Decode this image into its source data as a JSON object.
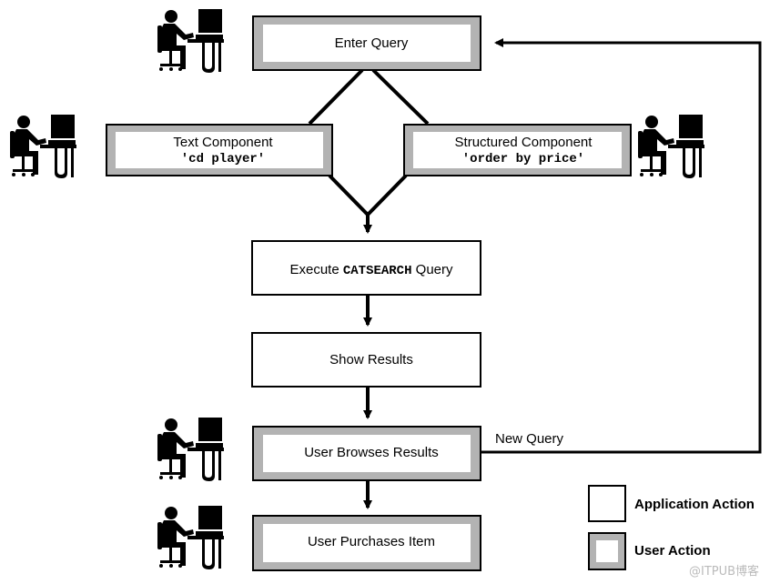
{
  "nodes": {
    "enter_query": "Enter Query",
    "text_component": {
      "label": "Text Component",
      "value": "'cd player'"
    },
    "structured_component": {
      "label": "Structured Component",
      "value": "'order by price'"
    },
    "execute": {
      "prefix": "Execute ",
      "keyword": "CATSEARCH",
      "suffix": " Query"
    },
    "show_results": "Show Results",
    "user_browses": "User Browses Results",
    "user_purchases": "User Purchases Item"
  },
  "edges": {
    "new_query": "New Query"
  },
  "legend": {
    "application_action": "Application Action",
    "user_action": "User Action"
  },
  "watermark": "@ITPUB博客",
  "colors": {
    "user_action_frame": "#b3b3b3",
    "stroke": "#000000"
  },
  "icons": [
    "user-at-computer-icon"
  ]
}
